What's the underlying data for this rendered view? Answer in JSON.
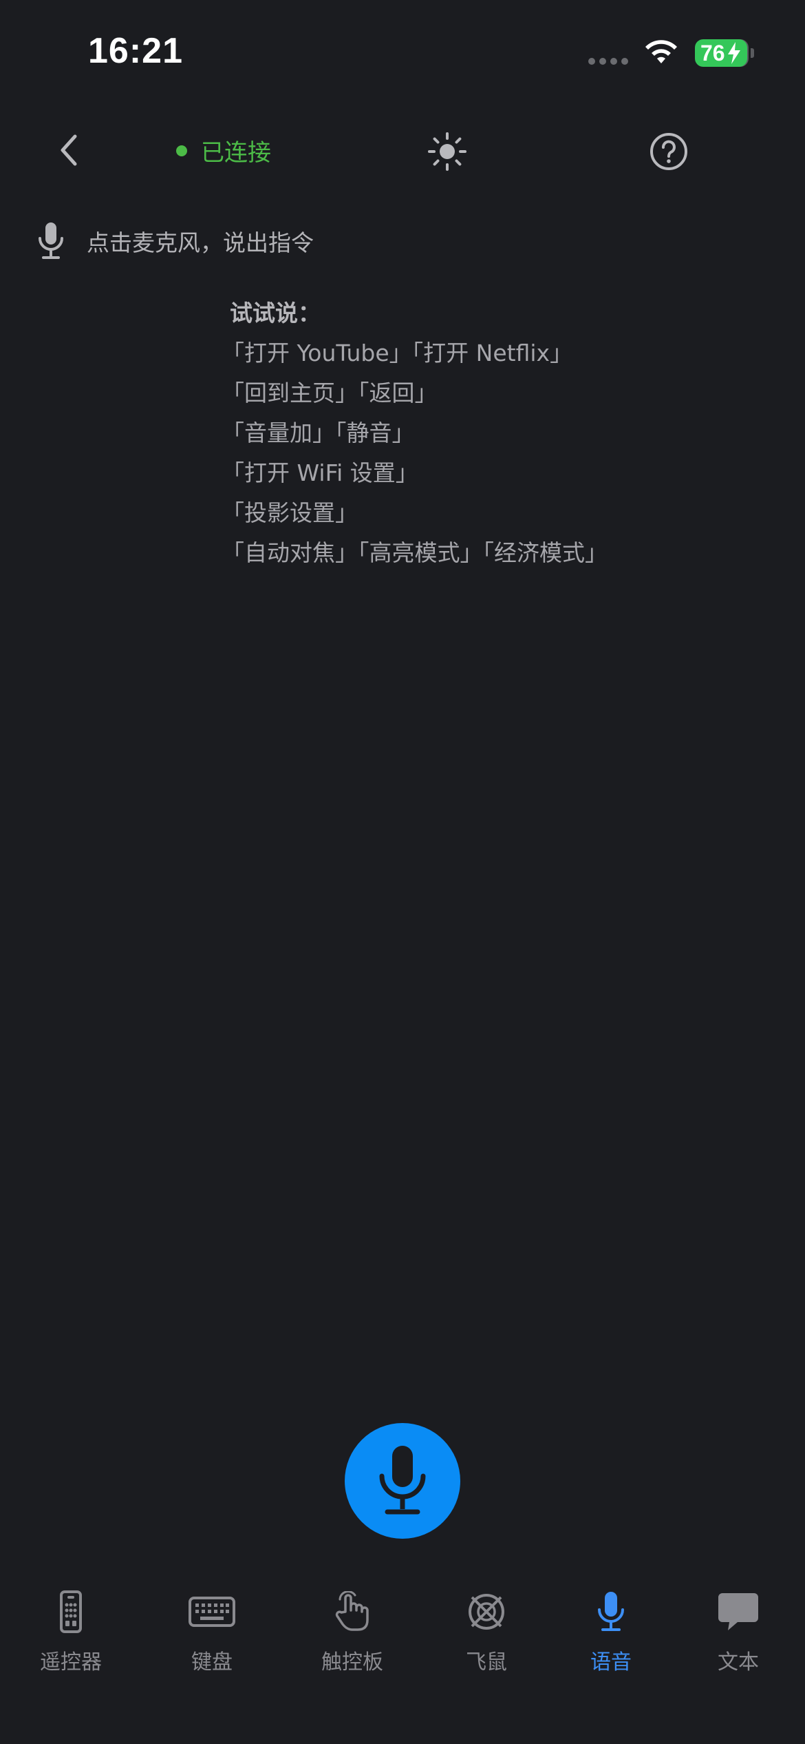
{
  "status_bar": {
    "time": "16:21",
    "battery": "76"
  },
  "header": {
    "connection_status": "已连接",
    "colors": {
      "connected": "#4cbb47",
      "accent": "#0a8cf5",
      "active_tab": "#3d8ff5"
    }
  },
  "prompt": {
    "text": "点击麦克风，说出指令",
    "icon": "microphone-icon"
  },
  "examples": {
    "title": "试试说：",
    "lines": [
      "「打开 YouTube」「打开 Netflix」",
      "「回到主页」「返回」",
      "「音量加」「静音」",
      "「打开 WiFi 设置」",
      "「投影设置」",
      "「自动对焦」「高亮模式」「经济模式」"
    ]
  },
  "tabs": [
    {
      "label": "遥控器",
      "icon": "remote-icon",
      "active": false
    },
    {
      "label": "键盘",
      "icon": "keyboard-icon",
      "active": false
    },
    {
      "label": "触控板",
      "icon": "touch-hand-icon",
      "active": false
    },
    {
      "label": "飞鼠",
      "icon": "air-mouse-icon",
      "active": false
    },
    {
      "label": "语音",
      "icon": "microphone-icon",
      "active": true
    },
    {
      "label": "文本",
      "icon": "chat-bubble-icon",
      "active": false
    }
  ]
}
